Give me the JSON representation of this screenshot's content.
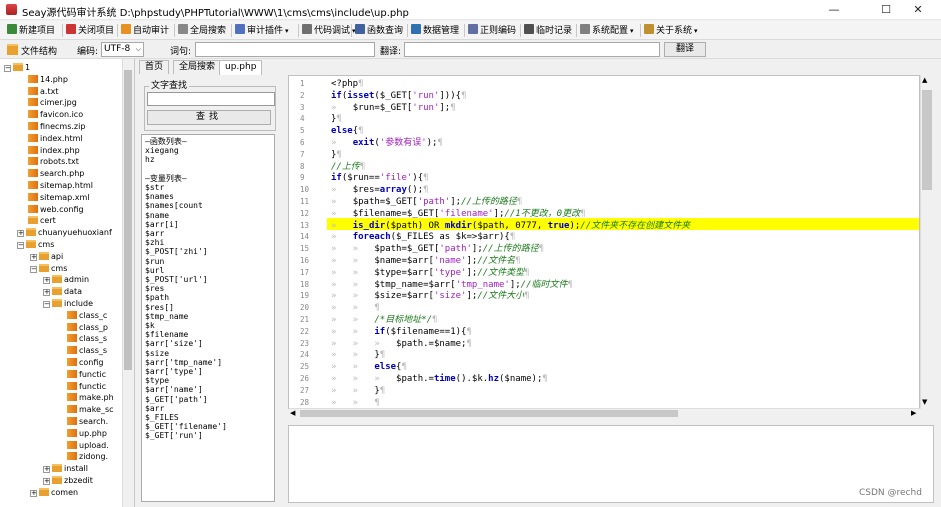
{
  "window": {
    "title": "Seay源代码审计系统  D:\\phpstudy\\PHPTutorial\\WWW\\1\\cms\\cms\\include\\up.php",
    "minimize": "—",
    "maximize": "☐",
    "close": "✕"
  },
  "toolbar": [
    {
      "label": "新建项目",
      "color": "#3a8a3a"
    },
    {
      "label": "关闭项目",
      "color": "#cc3333"
    },
    {
      "label": "自动审计",
      "color": "#e89020"
    },
    {
      "label": "全局搜索",
      "color": "#888888"
    },
    {
      "label": "审计插件",
      "color": "#5070c0",
      "dropdown": "▾"
    },
    {
      "label": "代码调试",
      "color": "#707070",
      "dropdown": "▾"
    },
    {
      "label": "函数查询",
      "color": "#4060a0"
    },
    {
      "label": "数据管理",
      "color": "#3070b0"
    },
    {
      "label": "正则编码",
      "color": "#6070a0"
    },
    {
      "label": "临时记录",
      "color": "#505050"
    },
    {
      "label": "系统配置",
      "color": "#808080",
      "dropdown": "▾"
    },
    {
      "label": "关于系统",
      "color": "#c09030",
      "dropdown": "▾"
    }
  ],
  "toolbar2": {
    "structure_label": "文件结构",
    "encoding_label": "编码:",
    "encoding_value": "UTF-8",
    "word_label": "词句:",
    "word_value": "",
    "translate_label": "翻译:",
    "translate_value": "",
    "translate_button": "翻译"
  },
  "tree": [
    {
      "label": "1",
      "type": "folder",
      "toggle": "−",
      "depth": 0
    },
    {
      "label": "14.php",
      "type": "file",
      "depth": 1
    },
    {
      "label": "a.txt",
      "type": "file",
      "depth": 1
    },
    {
      "label": "cimer.jpg",
      "type": "file",
      "depth": 1
    },
    {
      "label": "favicon.ico",
      "type": "file",
      "depth": 1
    },
    {
      "label": "finecms.zip",
      "type": "file",
      "depth": 1
    },
    {
      "label": "index.html",
      "type": "file",
      "depth": 1
    },
    {
      "label": "index.php",
      "type": "file",
      "depth": 1
    },
    {
      "label": "robots.txt",
      "type": "file",
      "depth": 1
    },
    {
      "label": "search.php",
      "type": "file",
      "depth": 1
    },
    {
      "label": "sitemap.html",
      "type": "file",
      "depth": 1
    },
    {
      "label": "sitemap.xml",
      "type": "file",
      "depth": 1
    },
    {
      "label": "web.config",
      "type": "file",
      "depth": 1
    },
    {
      "label": "cert",
      "type": "folder",
      "depth": 1
    },
    {
      "label": "chuanyuehuoxianf",
      "type": "folder",
      "toggle": "+",
      "depth": 1
    },
    {
      "label": "cms",
      "type": "folder",
      "toggle": "−",
      "depth": 1
    },
    {
      "label": "api",
      "type": "folder",
      "toggle": "+",
      "depth": 2
    },
    {
      "label": "cms",
      "type": "folder",
      "toggle": "−",
      "depth": 2
    },
    {
      "label": "admin",
      "type": "folder",
      "toggle": "+",
      "depth": 3
    },
    {
      "label": "data",
      "type": "folder",
      "toggle": "+",
      "depth": 3
    },
    {
      "label": "include",
      "type": "folder",
      "toggle": "−",
      "depth": 3
    },
    {
      "label": "class_c",
      "type": "file",
      "depth": 4
    },
    {
      "label": "class_p",
      "type": "file",
      "depth": 4
    },
    {
      "label": "class_s",
      "type": "file",
      "depth": 4
    },
    {
      "label": "class_s",
      "type": "file",
      "depth": 4
    },
    {
      "label": "config",
      "type": "file",
      "depth": 4
    },
    {
      "label": "functic",
      "type": "file",
      "depth": 4
    },
    {
      "label": "functic",
      "type": "file",
      "depth": 4
    },
    {
      "label": "make.ph",
      "type": "file",
      "depth": 4
    },
    {
      "label": "make_sc",
      "type": "file",
      "depth": 4
    },
    {
      "label": "search.",
      "type": "file",
      "depth": 4
    },
    {
      "label": "up.php",
      "type": "file",
      "depth": 4
    },
    {
      "label": "upload.",
      "type": "file",
      "depth": 4
    },
    {
      "label": "zidong.",
      "type": "file",
      "depth": 4
    },
    {
      "label": "install",
      "type": "folder",
      "toggle": "+",
      "depth": 3
    },
    {
      "label": "zbzedit",
      "type": "folder",
      "toggle": "+",
      "depth": 3
    },
    {
      "label": "comen",
      "type": "folder",
      "toggle": "+",
      "depth": 2
    }
  ],
  "tabs": [
    "首页",
    "全局搜索",
    "up.php"
  ],
  "funcpanel": {
    "title": "文字查找",
    "search_value": "",
    "search_button": "查找",
    "lines": [
      "—函数列表—",
      "xiegang",
      "hz",
      "",
      "—变量列表—",
      "$str",
      "$names",
      "$names[count",
      "$name",
      "$arr[i]",
      "$arr",
      "$zhi",
      "$_POST['zhi']",
      "$run",
      "$url",
      "$_POST['url']",
      "$res",
      "$path",
      "$res[]",
      "$tmp_name",
      "$k",
      "$filename",
      "$arr['size']",
      "$size",
      "$arr['tmp_name']",
      "$arr['type']",
      "$type",
      "$arr['name']",
      "$_GET['path']",
      "$arr",
      "$_FILES",
      "$_GET['filename']",
      "$_GET['run']"
    ]
  },
  "editor": {
    "line_numbers": [
      "1",
      "2",
      "3",
      "4",
      "5",
      "6",
      "7",
      "8",
      "9",
      "10",
      "11",
      "12",
      "13",
      "14",
      "15",
      "16",
      "17",
      "18",
      "19",
      "20",
      "21",
      "22",
      "23",
      "24",
      "25",
      "26",
      "27",
      "28"
    ],
    "highlighted_line": 13,
    "code": [
      [
        {
          "t": "<?php",
          "c": "va"
        },
        {
          "t": "¶",
          "c": "ws"
        }
      ],
      [
        {
          "t": "if",
          "c": "kw"
        },
        {
          "t": "(",
          "c": "va"
        },
        {
          "t": "isset",
          "c": "kw"
        },
        {
          "t": "($_GET[",
          "c": "va"
        },
        {
          "t": "'run'",
          "c": "st"
        },
        {
          "t": "])){",
          "c": "va"
        },
        {
          "t": "¶",
          "c": "ws"
        }
      ],
      [
        {
          "t": "»   ",
          "c": "ws"
        },
        {
          "t": "$run=$_GET[",
          "c": "va"
        },
        {
          "t": "'run'",
          "c": "st"
        },
        {
          "t": "];",
          "c": "va"
        },
        {
          "t": "¶",
          "c": "ws"
        }
      ],
      [
        {
          "t": "}",
          "c": "va"
        },
        {
          "t": "¶",
          "c": "ws"
        }
      ],
      [
        {
          "t": "else",
          "c": "kw"
        },
        {
          "t": "{",
          "c": "va"
        },
        {
          "t": "¶",
          "c": "ws"
        }
      ],
      [
        {
          "t": "»   ",
          "c": "ws"
        },
        {
          "t": "exit",
          "c": "kw"
        },
        {
          "t": "(",
          "c": "va"
        },
        {
          "t": "'参数有误'",
          "c": "st"
        },
        {
          "t": ");",
          "c": "va"
        },
        {
          "t": "¶",
          "c": "ws"
        }
      ],
      [
        {
          "t": "}",
          "c": "va"
        },
        {
          "t": "¶",
          "c": "ws"
        }
      ],
      [
        {
          "t": "//上传",
          "c": "cm"
        },
        {
          "t": "¶",
          "c": "ws"
        }
      ],
      [
        {
          "t": "if",
          "c": "kw"
        },
        {
          "t": "($run==",
          "c": "va"
        },
        {
          "t": "'file'",
          "c": "st"
        },
        {
          "t": "){",
          "c": "va"
        },
        {
          "t": "¶",
          "c": "ws"
        }
      ],
      [
        {
          "t": "»   ",
          "c": "ws"
        },
        {
          "t": "$res=",
          "c": "va"
        },
        {
          "t": "array",
          "c": "kw"
        },
        {
          "t": "();",
          "c": "va"
        },
        {
          "t": "¶",
          "c": "ws"
        }
      ],
      [
        {
          "t": "»   ",
          "c": "ws"
        },
        {
          "t": "$path=$_GET[",
          "c": "va"
        },
        {
          "t": "'path'",
          "c": "st"
        },
        {
          "t": "];",
          "c": "va"
        },
        {
          "t": "//上传的路径",
          "c": "cm"
        },
        {
          "t": "¶",
          "c": "ws"
        }
      ],
      [
        {
          "t": "»   ",
          "c": "ws"
        },
        {
          "t": "$filename=$_GET[",
          "c": "va"
        },
        {
          "t": "'filename'",
          "c": "st"
        },
        {
          "t": "];",
          "c": "va"
        },
        {
          "t": "//1不更改，0更改",
          "c": "cm"
        },
        {
          "t": "¶",
          "c": "ws"
        }
      ],
      [
        {
          "t": "»   ",
          "c": "ws"
        },
        {
          "t": "is_dir",
          "c": "kw"
        },
        {
          "t": "($path) OR ",
          "c": "va"
        },
        {
          "t": "mkdir",
          "c": "kw"
        },
        {
          "t": "($path, 0777, ",
          "c": "va"
        },
        {
          "t": "true",
          "c": "kw"
        },
        {
          "t": ");",
          "c": "va"
        },
        {
          "t": "//文件夹不存在创建文件夹",
          "c": "cm"
        }
      ],
      [
        {
          "t": "»   ",
          "c": "ws"
        },
        {
          "t": "foreach",
          "c": "kw"
        },
        {
          "t": "($_FILES as $k=>$arr){",
          "c": "va"
        },
        {
          "t": "¶",
          "c": "ws"
        }
      ],
      [
        {
          "t": "»   »   ",
          "c": "ws"
        },
        {
          "t": "$path=$_GET[",
          "c": "va"
        },
        {
          "t": "'path'",
          "c": "st"
        },
        {
          "t": "];",
          "c": "va"
        },
        {
          "t": "//上传的路径",
          "c": "cm"
        },
        {
          "t": "¶",
          "c": "ws"
        }
      ],
      [
        {
          "t": "»   »   ",
          "c": "ws"
        },
        {
          "t": "$name=$arr[",
          "c": "va"
        },
        {
          "t": "'name'",
          "c": "st"
        },
        {
          "t": "];",
          "c": "va"
        },
        {
          "t": "//文件名",
          "c": "cm"
        },
        {
          "t": "¶",
          "c": "ws"
        }
      ],
      [
        {
          "t": "»   »   ",
          "c": "ws"
        },
        {
          "t": "$type=$arr[",
          "c": "va"
        },
        {
          "t": "'type'",
          "c": "st"
        },
        {
          "t": "];",
          "c": "va"
        },
        {
          "t": "//文件类型",
          "c": "cm"
        },
        {
          "t": "¶",
          "c": "ws"
        }
      ],
      [
        {
          "t": "»   »   ",
          "c": "ws"
        },
        {
          "t": "$tmp_name=$arr[",
          "c": "va"
        },
        {
          "t": "'tmp_name'",
          "c": "st"
        },
        {
          "t": "];",
          "c": "va"
        },
        {
          "t": "//临时文件",
          "c": "cm"
        },
        {
          "t": "¶",
          "c": "ws"
        }
      ],
      [
        {
          "t": "»   »   ",
          "c": "ws"
        },
        {
          "t": "$size=$arr[",
          "c": "va"
        },
        {
          "t": "'size'",
          "c": "st"
        },
        {
          "t": "];",
          "c": "va"
        },
        {
          "t": "//文件大小",
          "c": "cm"
        },
        {
          "t": "¶",
          "c": "ws"
        }
      ],
      [
        {
          "t": "»   »   ",
          "c": "ws"
        },
        {
          "t": "¶",
          "c": "ws"
        }
      ],
      [
        {
          "t": "»   »   ",
          "c": "ws"
        },
        {
          "t": "/*目标地址*/",
          "c": "cm"
        },
        {
          "t": "¶",
          "c": "ws"
        }
      ],
      [
        {
          "t": "»   »   ",
          "c": "ws"
        },
        {
          "t": "if",
          "c": "kw"
        },
        {
          "t": "($filename==1){",
          "c": "va"
        },
        {
          "t": "¶",
          "c": "ws"
        }
      ],
      [
        {
          "t": "»   »   »   ",
          "c": "ws"
        },
        {
          "t": "$path.=$name;",
          "c": "va"
        },
        {
          "t": "¶",
          "c": "ws"
        }
      ],
      [
        {
          "t": "»   »   ",
          "c": "ws"
        },
        {
          "t": "}",
          "c": "va"
        },
        {
          "t": "¶",
          "c": "ws"
        }
      ],
      [
        {
          "t": "»   »   ",
          "c": "ws"
        },
        {
          "t": "else",
          "c": "kw"
        },
        {
          "t": "{",
          "c": "va"
        },
        {
          "t": "¶",
          "c": "ws"
        }
      ],
      [
        {
          "t": "»   »   »   ",
          "c": "ws"
        },
        {
          "t": "$path.=",
          "c": "va"
        },
        {
          "t": "time",
          "c": "kw"
        },
        {
          "t": "().$k.",
          "c": "va"
        },
        {
          "t": "hz",
          "c": "kw"
        },
        {
          "t": "($name);",
          "c": "va"
        },
        {
          "t": "¶",
          "c": "ws"
        }
      ],
      [
        {
          "t": "»   »   ",
          "c": "ws"
        },
        {
          "t": "}",
          "c": "va"
        },
        {
          "t": "¶",
          "c": "ws"
        }
      ],
      [
        {
          "t": "»   »   ",
          "c": "ws"
        },
        {
          "t": "¶",
          "c": "ws"
        }
      ]
    ]
  },
  "watermark": "CSDN @rechd"
}
